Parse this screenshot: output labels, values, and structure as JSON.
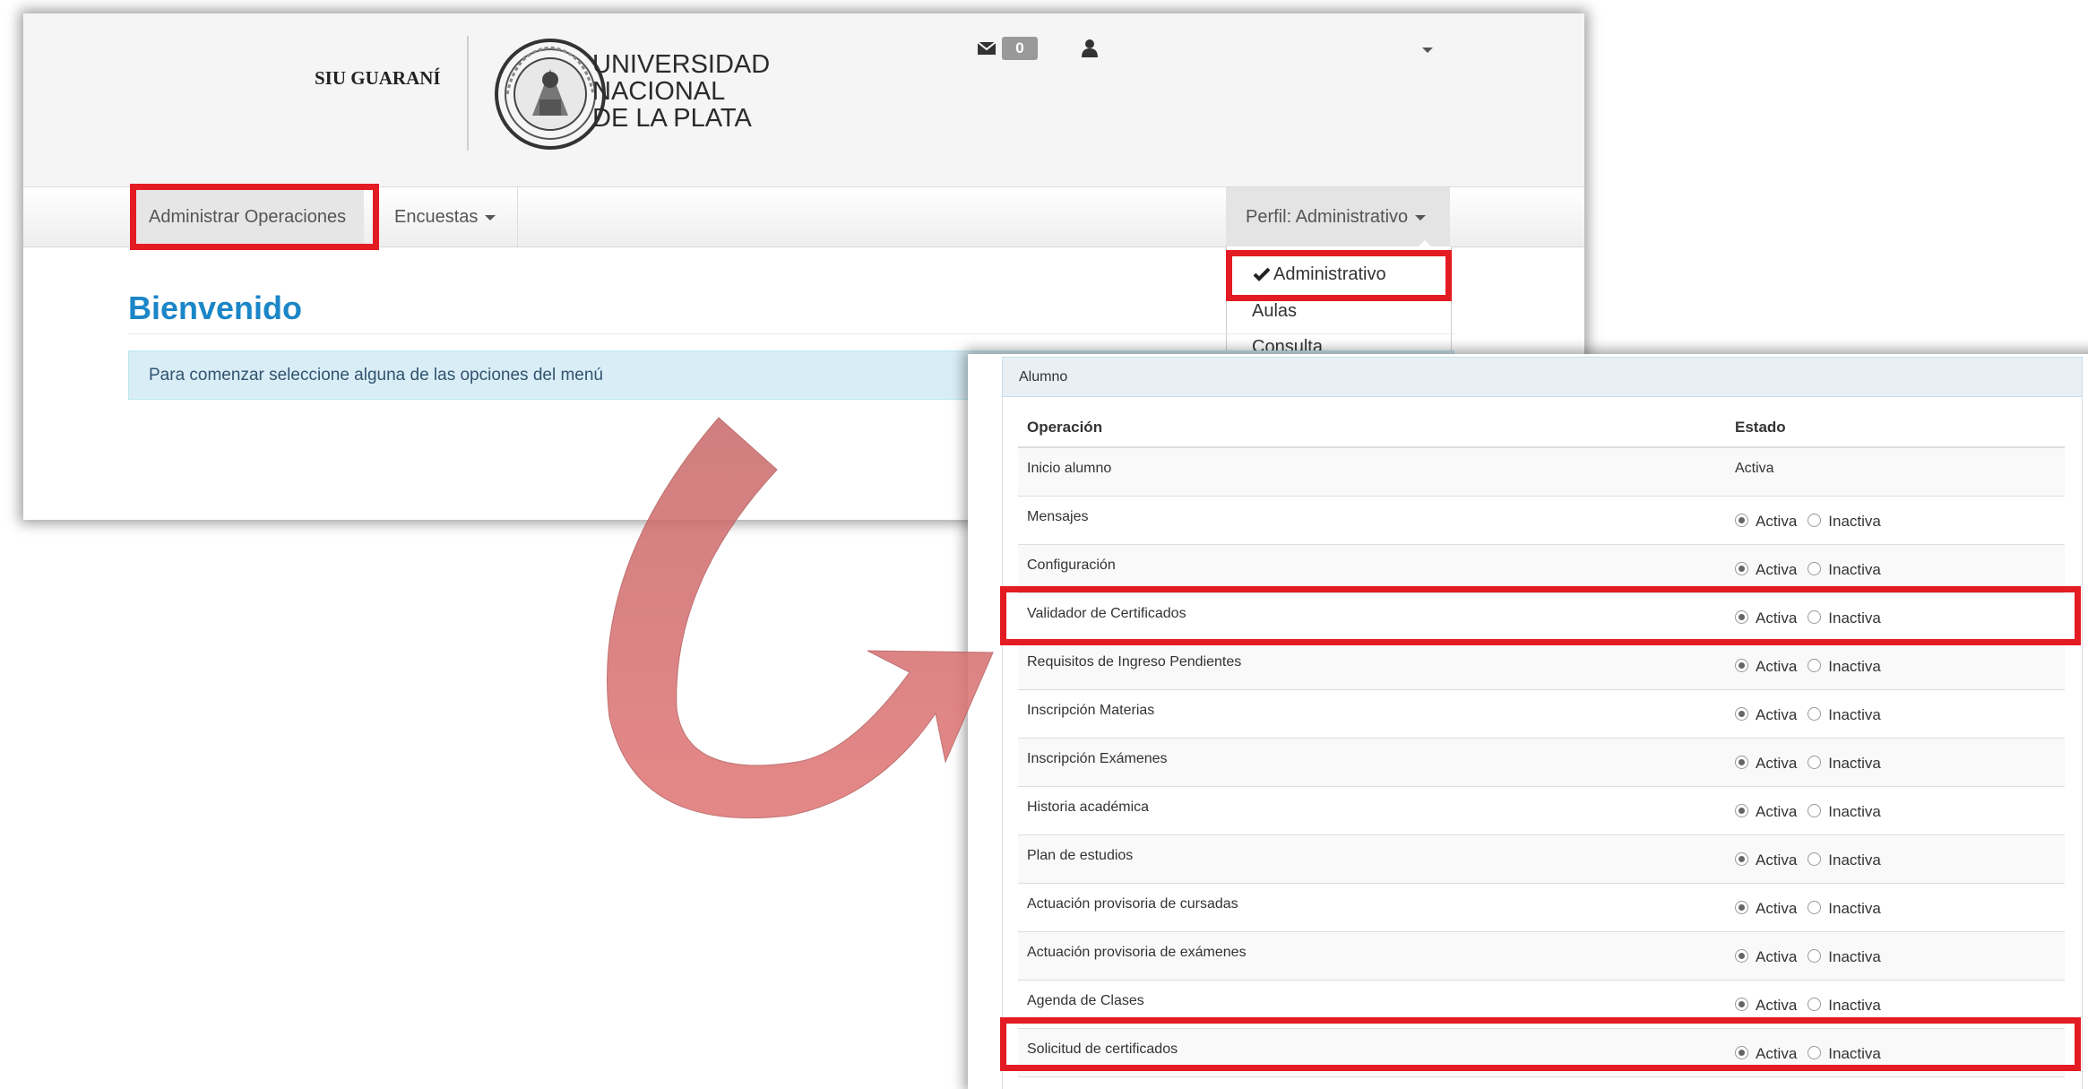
{
  "header": {
    "brand": "SIU GUARANÍ",
    "university_lines": [
      "UNIVERSIDAD",
      "NACIONAL",
      "DE LA PLATA"
    ],
    "message_count": "0",
    "icons": {
      "mail": "envelope-icon",
      "user": "user-icon"
    }
  },
  "nav": {
    "admin_label": "Administrar Operaciones",
    "encuestas_label": "Encuestas",
    "perfil_label": "Perfil: Administrativo"
  },
  "dropdown": {
    "items": [
      "Administrativo",
      "Aulas",
      "Consulta"
    ],
    "selected": "Administrativo"
  },
  "main": {
    "title": "Bienvenido",
    "info": "Para comenzar seleccione alguna de las opciones del menú"
  },
  "panel": {
    "title": "Alumno",
    "columns": [
      "Operación",
      "Estado"
    ],
    "option_active": "Activa",
    "option_inactive": "Inactiva",
    "rows": [
      {
        "name": "Inicio alumno",
        "estado": "Activa",
        "static": true
      },
      {
        "name": "Mensajes",
        "estado": "Activa"
      },
      {
        "name": "Configuración",
        "estado": "Activa"
      },
      {
        "name": "Validador de Certificados",
        "estado": "Activa"
      },
      {
        "name": "Requisitos de Ingreso Pendientes",
        "estado": "Activa"
      },
      {
        "name": "Inscripción Materias",
        "estado": "Activa"
      },
      {
        "name": "Inscripción Exámenes",
        "estado": "Activa"
      },
      {
        "name": "Historia académica",
        "estado": "Activa"
      },
      {
        "name": "Plan de estudios",
        "estado": "Activa"
      },
      {
        "name": "Actuación provisoria de cursadas",
        "estado": "Activa"
      },
      {
        "name": "Actuación provisoria de exámenes",
        "estado": "Activa"
      },
      {
        "name": "Agenda de Clases",
        "estado": "Activa"
      },
      {
        "name": "Solicitud de certificados",
        "estado": "Activa"
      }
    ]
  },
  "colors": {
    "highlight": "#e31b23",
    "arrow": "#d9605f",
    "title_blue": "#1b86c7"
  }
}
